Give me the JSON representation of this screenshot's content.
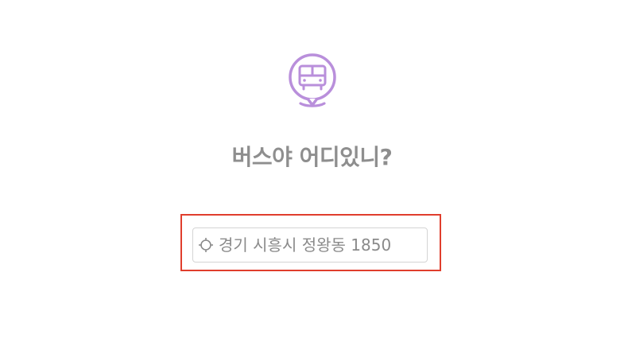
{
  "app": {
    "title": "버스야 어디있니?"
  },
  "location": {
    "address": "경기 시흥시 정왕동 1850",
    "icon": "crosshair-icon"
  },
  "colors": {
    "brand_purple": "#b98fdb",
    "title_gray": "#8e8e8e",
    "highlight_red": "#e03e2d"
  }
}
